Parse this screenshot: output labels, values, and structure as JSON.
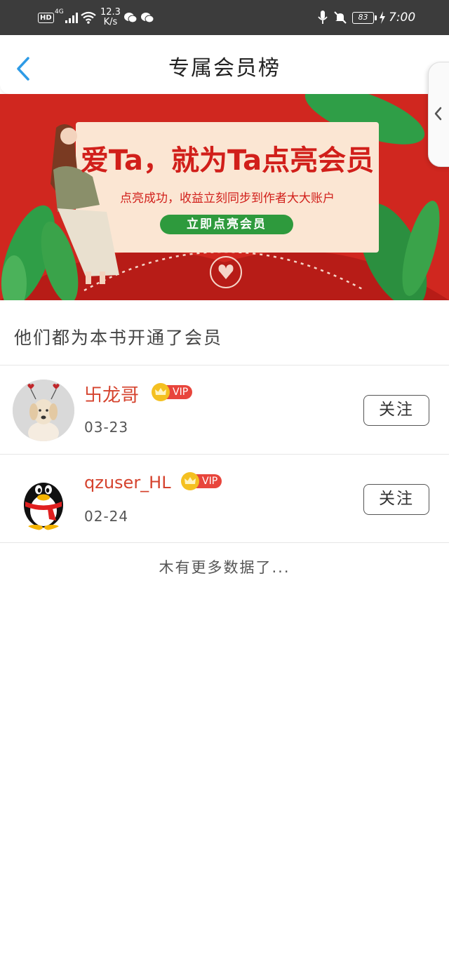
{
  "status_bar": {
    "hd": "HD",
    "signal": "4G",
    "speed_value": "12.3",
    "speed_unit": "K/s",
    "battery": "83",
    "time": "7:00"
  },
  "header": {
    "title": "专属会员榜"
  },
  "banner": {
    "headline": "爱Ta，就为Ta点亮会员",
    "subline": "点亮成功，收益立刻同步到作者大大账户",
    "cta": "立即点亮会员"
  },
  "section": {
    "title": "他们都为本书开通了会员"
  },
  "members": [
    {
      "name": "卐龙哥",
      "badge": "VIP",
      "date": "03-23",
      "follow": "关注",
      "avatar": "dog-avatar"
    },
    {
      "name": "qzuser_HL",
      "badge": "VIP",
      "date": "02-24",
      "follow": "关注",
      "avatar": "qq-penguin-avatar"
    }
  ],
  "footer": {
    "no_more": "木有更多数据了..."
  },
  "colors": {
    "accent_blue": "#2e9be6",
    "name_red": "#d5432e",
    "vip_red": "#e8453c",
    "banner_red": "#d0271f",
    "cta_green": "#2e9a3d"
  }
}
